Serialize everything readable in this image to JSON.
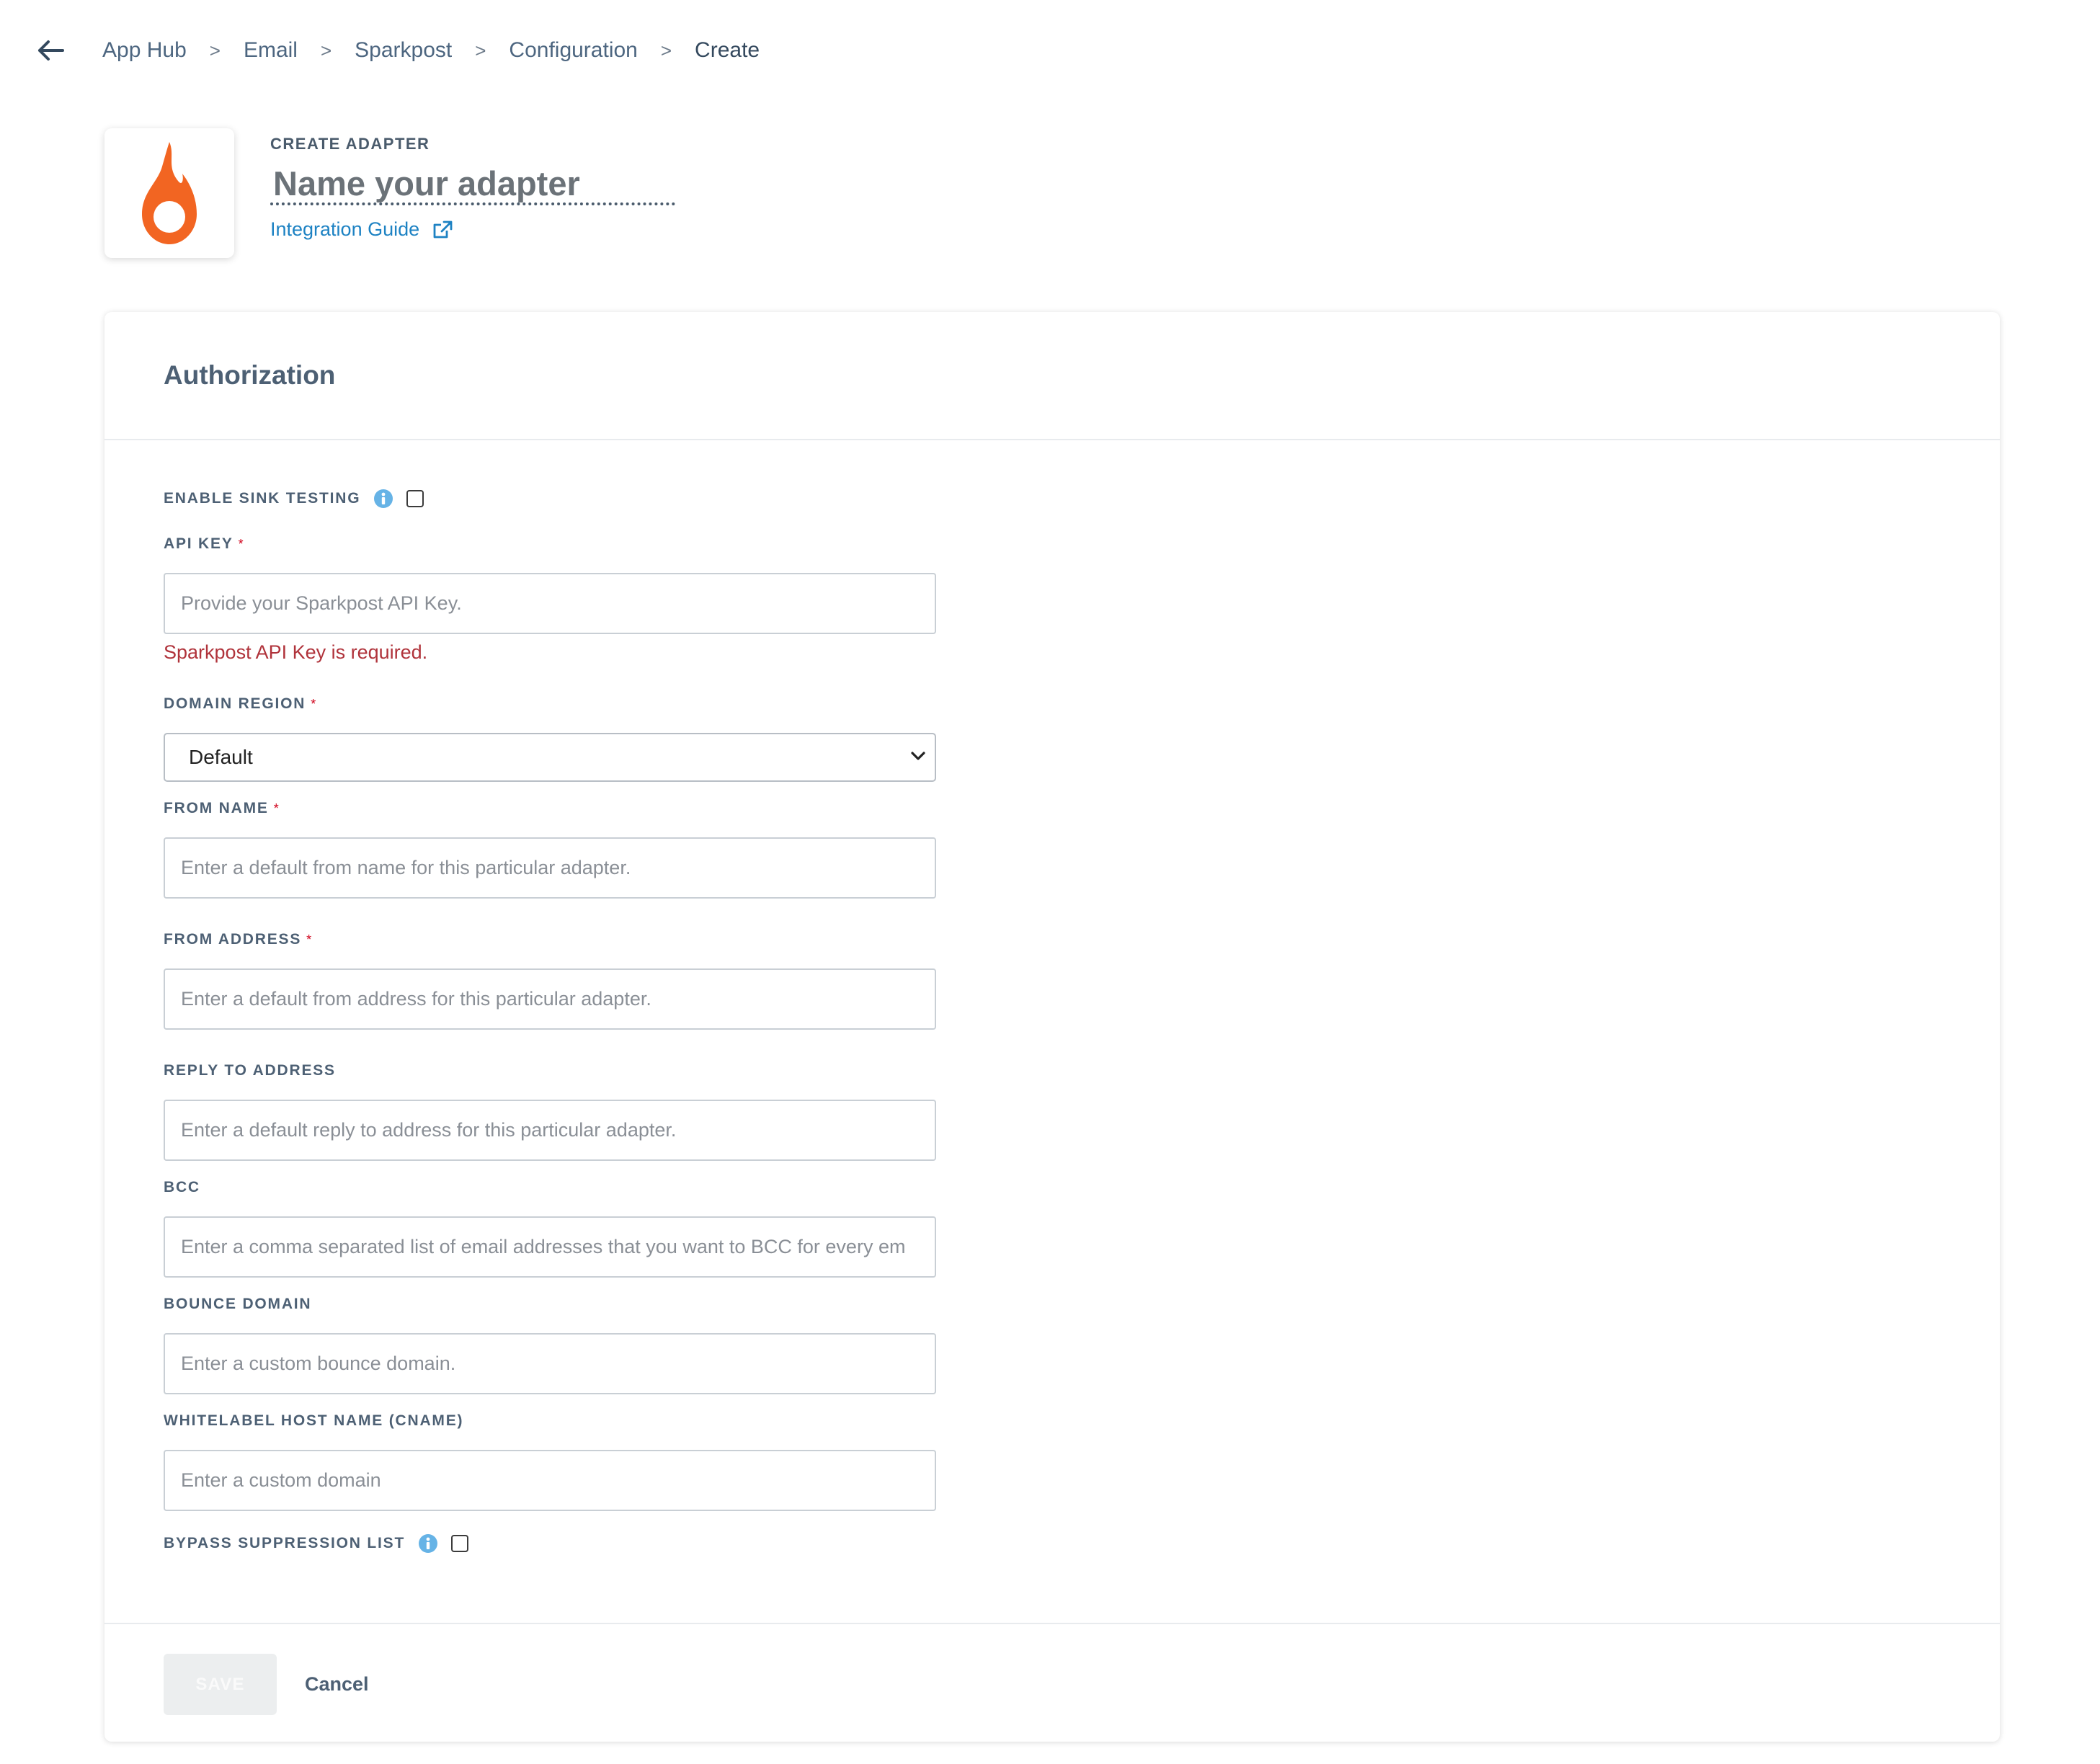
{
  "breadcrumb": {
    "items": [
      "App Hub",
      "Email",
      "Sparkpost",
      "Configuration"
    ],
    "current": "Create",
    "separator": ">"
  },
  "header": {
    "eyebrow": "CREATE ADAPTER",
    "name_placeholder": "Name your adapter",
    "guide_link": "Integration Guide",
    "logo_icon": "sparkpost-flame-logo",
    "logo_color": "#f26522"
  },
  "card": {
    "title": "Authorization",
    "sink_testing": {
      "label": "ENABLE SINK TESTING",
      "checked": false
    },
    "api_key": {
      "label": "API KEY",
      "required_mark": "*",
      "placeholder": "Provide your Sparkpost API Key.",
      "value": "",
      "error": "Sparkpost API Key is required."
    },
    "domain_region": {
      "label": "DOMAIN REGION",
      "required_mark": "*",
      "value": "Default"
    },
    "from_name": {
      "label": "FROM NAME",
      "required_mark": "*",
      "placeholder": "Enter a default from name for this particular adapter.",
      "value": ""
    },
    "from_address": {
      "label": "FROM ADDRESS",
      "required_mark": "*",
      "placeholder": "Enter a default from address for this particular adapter.",
      "value": ""
    },
    "reply_to": {
      "label": "REPLY TO ADDRESS",
      "placeholder": "Enter a default reply to address for this particular adapter.",
      "value": ""
    },
    "bcc": {
      "label": "BCC",
      "placeholder": "Enter a comma separated list of email addresses that you want to BCC for every em",
      "value": ""
    },
    "bounce_domain": {
      "label": "BOUNCE DOMAIN",
      "placeholder": "Enter a custom bounce domain.",
      "value": ""
    },
    "whitelabel": {
      "label": "WHITELABEL HOST NAME (CNAME)",
      "placeholder": "Enter a custom domain",
      "value": ""
    },
    "bypass_suppression": {
      "label": "BYPASS SUPPRESSION LIST",
      "checked": false
    }
  },
  "footer": {
    "save_label": "SAVE",
    "cancel_label": "Cancel"
  },
  "colors": {
    "link": "#1d82c3",
    "error": "#b0333b",
    "required": "#d0021b",
    "info_icon": "#66b3e6"
  }
}
